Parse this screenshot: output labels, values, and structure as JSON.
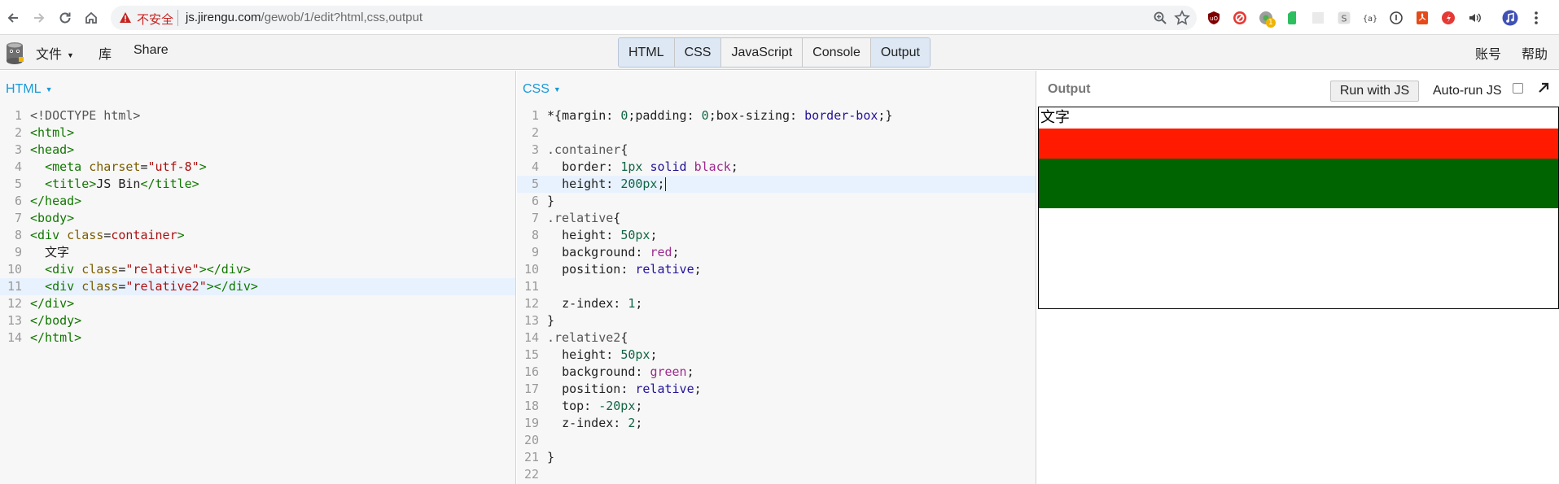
{
  "browser": {
    "insecure_label": "不安全",
    "url_host": "js.jirengu.com",
    "url_path": "/gewob/1/edit?html,css,output",
    "extensions": [
      "ublock-icon",
      "block-icon",
      "badge-extension-icon",
      "evernote-icon",
      "blank-extension-icon",
      "s-extension-icon",
      "code-extension-icon",
      "info-extension-icon",
      "pdf-extension-icon",
      "flash-extension-icon",
      "audio-extension-icon",
      "music-extension-icon",
      "menu-dots-icon"
    ],
    "extension_badge": "1"
  },
  "jsbin": {
    "file_menu": "文件",
    "library": "库",
    "share": "Share",
    "account": "账号",
    "help": "帮助",
    "panels": [
      "HTML",
      "CSS",
      "JavaScript",
      "Console",
      "Output"
    ],
    "active_panels": [
      "HTML",
      "CSS",
      "Output"
    ]
  },
  "html_panel": {
    "label": "HTML",
    "lines": [
      {
        "n": "1",
        "tokens": [
          [
            "t-doc",
            "<!DOCTYPE html>"
          ]
        ]
      },
      {
        "n": "2",
        "tokens": [
          [
            "t-tag",
            "<html>"
          ]
        ]
      },
      {
        "n": "3",
        "tokens": [
          [
            "t-tag",
            "<head>"
          ]
        ]
      },
      {
        "n": "4",
        "tokens": [
          [
            "t-text",
            "  "
          ],
          [
            "t-tag",
            "<meta "
          ],
          [
            "t-attr",
            "charset"
          ],
          [
            "t-text",
            "="
          ],
          [
            "t-str",
            "\"utf-8\""
          ],
          [
            "t-tag",
            ">"
          ]
        ]
      },
      {
        "n": "5",
        "tokens": [
          [
            "t-text",
            "  "
          ],
          [
            "t-tag",
            "<title>"
          ],
          [
            "t-text",
            "JS Bin"
          ],
          [
            "t-tag",
            "</title>"
          ]
        ]
      },
      {
        "n": "6",
        "tokens": [
          [
            "t-tag",
            "</head>"
          ]
        ]
      },
      {
        "n": "7",
        "tokens": [
          [
            "t-tag",
            "<body>"
          ]
        ]
      },
      {
        "n": "8",
        "tokens": [
          [
            "t-tag",
            "<div "
          ],
          [
            "t-attr",
            "class"
          ],
          [
            "t-text",
            "="
          ],
          [
            "t-str",
            "container"
          ],
          [
            "t-tag",
            ">"
          ]
        ]
      },
      {
        "n": "9",
        "tokens": [
          [
            "t-text",
            "  文字"
          ]
        ]
      },
      {
        "n": "10",
        "tokens": [
          [
            "t-text",
            "  "
          ],
          [
            "t-tag",
            "<div "
          ],
          [
            "t-attr",
            "class"
          ],
          [
            "t-text",
            "="
          ],
          [
            "t-str",
            "\"relative\""
          ],
          [
            "t-tag",
            "></div>"
          ]
        ]
      },
      {
        "n": "11",
        "hl": true,
        "tokens": [
          [
            "t-text",
            "  "
          ],
          [
            "t-tag",
            "<div "
          ],
          [
            "t-attr",
            "class"
          ],
          [
            "t-text",
            "="
          ],
          [
            "t-str",
            "\"relative2\""
          ],
          [
            "t-tag",
            "></div>"
          ]
        ]
      },
      {
        "n": "12",
        "tokens": [
          [
            "t-tag",
            "</div>"
          ]
        ]
      },
      {
        "n": "13",
        "tokens": [
          [
            "t-tag",
            "</body>"
          ]
        ]
      },
      {
        "n": "14",
        "tokens": [
          [
            "t-tag",
            "</html>"
          ]
        ]
      }
    ]
  },
  "css_panel": {
    "label": "CSS",
    "lines": [
      {
        "n": "1",
        "tokens": [
          [
            "t-punc",
            "*{"
          ],
          [
            "t-prop",
            "margin"
          ],
          [
            "t-punc",
            ": "
          ],
          [
            "t-num",
            "0"
          ],
          [
            "t-punc",
            ";"
          ],
          [
            "t-prop",
            "padding"
          ],
          [
            "t-punc",
            ": "
          ],
          [
            "t-num",
            "0"
          ],
          [
            "t-punc",
            ";"
          ],
          [
            "t-prop",
            "box-sizing"
          ],
          [
            "t-punc",
            ": "
          ],
          [
            "t-kw",
            "border-box"
          ],
          [
            "t-punc",
            ";}"
          ]
        ]
      },
      {
        "n": "2",
        "tokens": []
      },
      {
        "n": "3",
        "tokens": [
          [
            "t-sel",
            ".container"
          ],
          [
            "t-punc",
            "{"
          ]
        ]
      },
      {
        "n": "4",
        "tokens": [
          [
            "t-text",
            "  "
          ],
          [
            "t-prop",
            "border"
          ],
          [
            "t-punc",
            ": "
          ],
          [
            "t-num",
            "1px"
          ],
          [
            "t-text",
            " "
          ],
          [
            "t-kw",
            "solid"
          ],
          [
            "t-text",
            " "
          ],
          [
            "t-kw2",
            "black"
          ],
          [
            "t-punc",
            ";"
          ]
        ]
      },
      {
        "n": "5",
        "hl": true,
        "cursor": true,
        "tokens": [
          [
            "t-text",
            "  "
          ],
          [
            "t-prop",
            "height"
          ],
          [
            "t-punc",
            ": "
          ],
          [
            "t-num",
            "200px"
          ],
          [
            "t-punc",
            ";"
          ]
        ]
      },
      {
        "n": "6",
        "tokens": [
          [
            "t-punc",
            "}"
          ]
        ]
      },
      {
        "n": "7",
        "tokens": [
          [
            "t-sel",
            ".relative"
          ],
          [
            "t-punc",
            "{"
          ]
        ]
      },
      {
        "n": "8",
        "tokens": [
          [
            "t-text",
            "  "
          ],
          [
            "t-prop",
            "height"
          ],
          [
            "t-punc",
            ": "
          ],
          [
            "t-num",
            "50px"
          ],
          [
            "t-punc",
            ";"
          ]
        ]
      },
      {
        "n": "9",
        "tokens": [
          [
            "t-text",
            "  "
          ],
          [
            "t-prop",
            "background"
          ],
          [
            "t-punc",
            ": "
          ],
          [
            "t-kw2",
            "red"
          ],
          [
            "t-punc",
            ";"
          ]
        ]
      },
      {
        "n": "10",
        "tokens": [
          [
            "t-text",
            "  "
          ],
          [
            "t-prop",
            "position"
          ],
          [
            "t-punc",
            ": "
          ],
          [
            "t-kw",
            "relative"
          ],
          [
            "t-punc",
            ";"
          ]
        ]
      },
      {
        "n": "11",
        "tokens": []
      },
      {
        "n": "12",
        "tokens": [
          [
            "t-text",
            "  "
          ],
          [
            "t-prop",
            "z-index"
          ],
          [
            "t-punc",
            ": "
          ],
          [
            "t-num",
            "1"
          ],
          [
            "t-punc",
            ";"
          ]
        ]
      },
      {
        "n": "13",
        "tokens": [
          [
            "t-punc",
            "}"
          ]
        ]
      },
      {
        "n": "14",
        "tokens": [
          [
            "t-sel",
            ".relative2"
          ],
          [
            "t-punc",
            "{"
          ]
        ]
      },
      {
        "n": "15",
        "tokens": [
          [
            "t-text",
            "  "
          ],
          [
            "t-prop",
            "height"
          ],
          [
            "t-punc",
            ": "
          ],
          [
            "t-num",
            "50px"
          ],
          [
            "t-punc",
            ";"
          ]
        ]
      },
      {
        "n": "16",
        "tokens": [
          [
            "t-text",
            "  "
          ],
          [
            "t-prop",
            "background"
          ],
          [
            "t-punc",
            ": "
          ],
          [
            "t-kw2",
            "green"
          ],
          [
            "t-punc",
            ";"
          ]
        ]
      },
      {
        "n": "17",
        "tokens": [
          [
            "t-text",
            "  "
          ],
          [
            "t-prop",
            "position"
          ],
          [
            "t-punc",
            ": "
          ],
          [
            "t-kw",
            "relative"
          ],
          [
            "t-punc",
            ";"
          ]
        ]
      },
      {
        "n": "18",
        "tokens": [
          [
            "t-text",
            "  "
          ],
          [
            "t-prop",
            "top"
          ],
          [
            "t-punc",
            ": "
          ],
          [
            "t-num",
            "-20px"
          ],
          [
            "t-punc",
            ";"
          ]
        ]
      },
      {
        "n": "19",
        "tokens": [
          [
            "t-text",
            "  "
          ],
          [
            "t-prop",
            "z-index"
          ],
          [
            "t-punc",
            ": "
          ],
          [
            "t-num",
            "2"
          ],
          [
            "t-punc",
            ";"
          ]
        ]
      },
      {
        "n": "20",
        "tokens": []
      },
      {
        "n": "21",
        "tokens": [
          [
            "t-punc",
            "}"
          ]
        ]
      },
      {
        "n": "22",
        "tokens": []
      }
    ]
  },
  "output_panel": {
    "label": "Output",
    "run_button": "Run with JS",
    "autorun_label": "Auto-run JS",
    "autorun_checked": false,
    "rendered_text": "文字",
    "colors": {
      "red_box": "#ff1a00",
      "green_box": "#006400"
    }
  }
}
